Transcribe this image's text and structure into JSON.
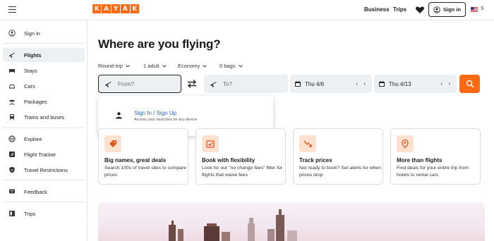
{
  "header": {
    "logo_letters": [
      "K",
      "A",
      "Y",
      "A",
      "K"
    ],
    "business": "Business",
    "trips": "Trips",
    "signin": "Sign in",
    "lang": "S",
    "brand_color": "#ff690f"
  },
  "sidebar": {
    "items": [
      {
        "label": "Sign in",
        "icon": "user-circle-icon"
      },
      {
        "label": "Flights",
        "icon": "plane-icon",
        "active": true
      },
      {
        "label": "Stays",
        "icon": "bed-icon"
      },
      {
        "label": "Cars",
        "icon": "car-icon"
      },
      {
        "label": "Packages",
        "icon": "umbrella-icon"
      },
      {
        "label": "Trains and buses",
        "icon": "train-icon"
      },
      {
        "label": "Explore",
        "icon": "globe-icon"
      },
      {
        "label": "Flight Tracker",
        "icon": "flight-tracker-icon"
      },
      {
        "label": "Travel Restrictions",
        "icon": "shield-icon"
      },
      {
        "label": "Feedback",
        "icon": "feedback-icon"
      },
      {
        "label": "Trips",
        "icon": "trips-icon"
      }
    ]
  },
  "main": {
    "title": "Where are you flying?",
    "options": {
      "trip_type": "Round-trip",
      "travelers": "1 adult",
      "cabin": "Economy",
      "bags": "0 bags"
    },
    "from_placeholder": "From?",
    "to_placeholder": "To?",
    "depart": "Thu 4/6",
    "return": "Thu 4/13",
    "dropdown": {
      "link_signin": "Sign In",
      "link_sep": " / ",
      "link_signup": "Sign Up",
      "subtext": "Access your searches on any device"
    },
    "cards": [
      {
        "title": "Big names, great deals",
        "desc": "Search 100s of travel sites to compare prices",
        "icon": "tag-icon"
      },
      {
        "title": "Book with flexibility",
        "desc": "Look for our \"no change fees\" filter for flights that waive fees",
        "icon": "flex-calendar-icon"
      },
      {
        "title": "Track prices",
        "desc": "Not ready to book? Set alerts for when prices drop",
        "icon": "price-trend-icon"
      },
      {
        "title": "More than flights",
        "desc": "Find deals for your entire trip from hotels to rental cars",
        "icon": "map-pin-icon"
      }
    ]
  }
}
